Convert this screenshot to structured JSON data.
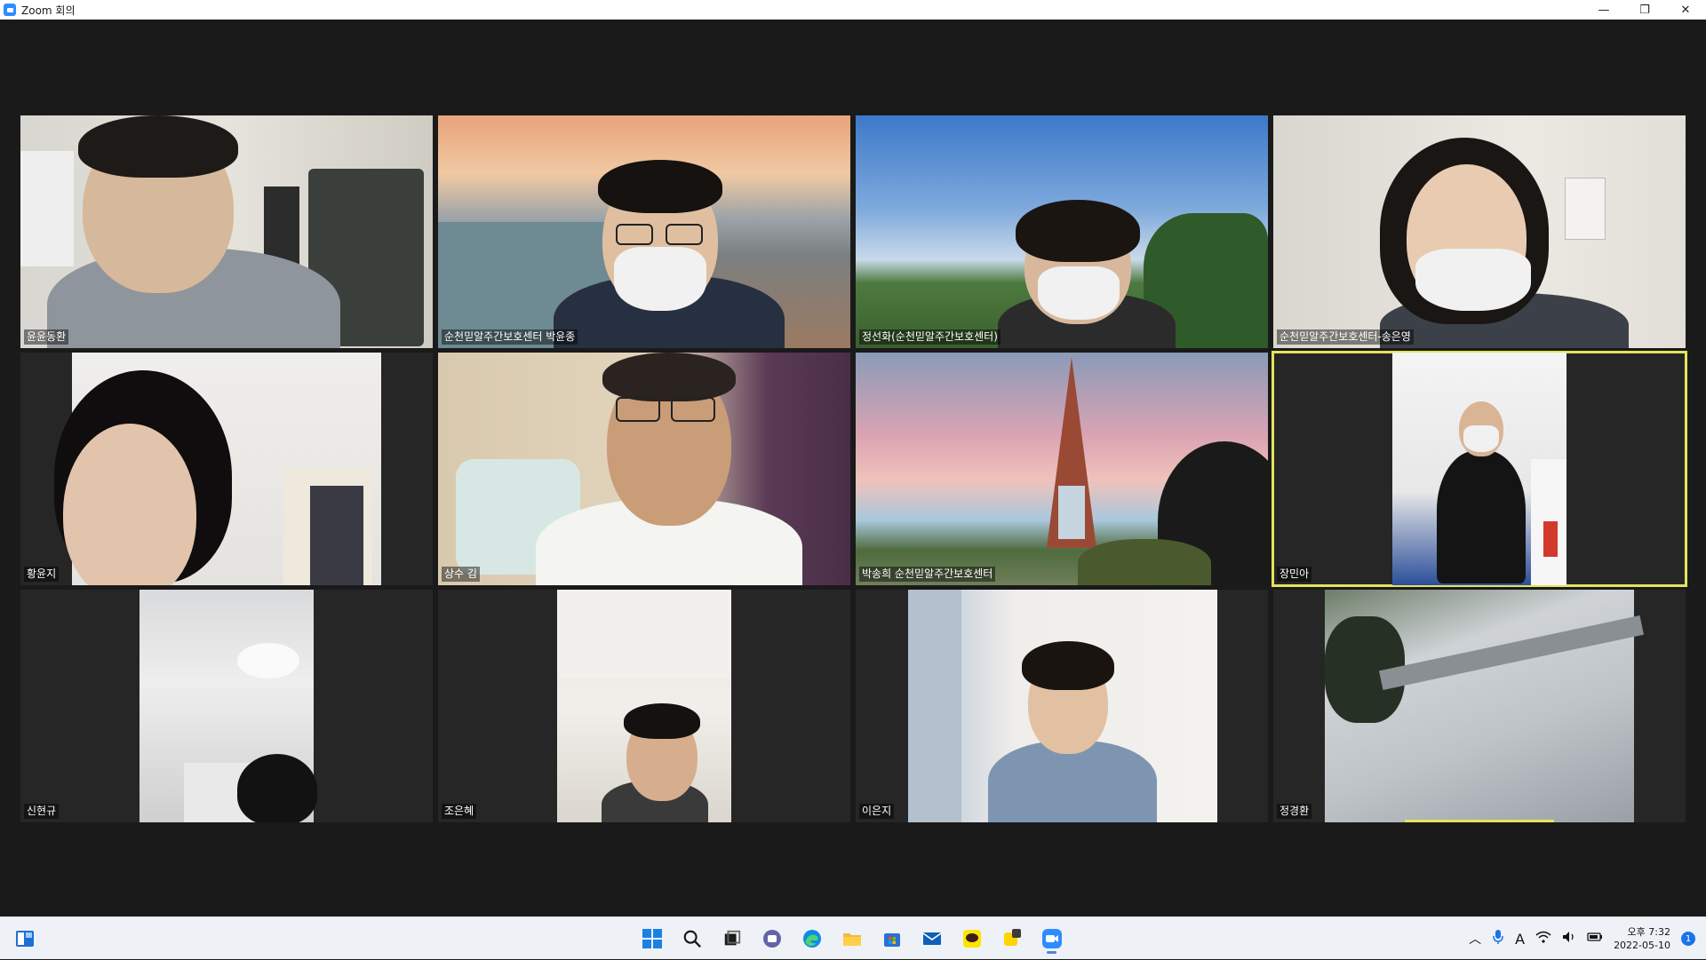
{
  "window": {
    "title": "Zoom 회의",
    "minimize": "—",
    "restore": "❐",
    "close": "✕"
  },
  "participants": [
    {
      "name": "윤윤동환"
    },
    {
      "name": "순천믿알주간보호센터 박윤종"
    },
    {
      "name": "정선화(순천믿알주간보호센터)"
    },
    {
      "name": "순천믿알주간보호센터-송은영"
    },
    {
      "name": "황윤지"
    },
    {
      "name": "상수 김"
    },
    {
      "name": "박송희 순천믿알주간보호센터"
    },
    {
      "name": "장민아"
    },
    {
      "name": "신현규"
    },
    {
      "name": "조은혜"
    },
    {
      "name": "이은지"
    },
    {
      "name": "정경환"
    }
  ],
  "active_speaker_index": 7,
  "taskbar": {
    "icons": [
      "windows-start-icon",
      "search-icon",
      "task-view-icon",
      "teams-chat-icon",
      "edge-icon",
      "file-explorer-icon",
      "microsoft-store-icon",
      "mail-icon",
      "kakaotalk-icon",
      "kakao-note-icon",
      "zoom-icon"
    ],
    "tray": {
      "ime": "A",
      "time": "오후 7:32",
      "date": "2022-05-10",
      "notifications": "1"
    }
  },
  "colors": {
    "active_border": "#e4e35c",
    "zoom_blue": "#2d8cff",
    "background": "#1a1a1a"
  }
}
